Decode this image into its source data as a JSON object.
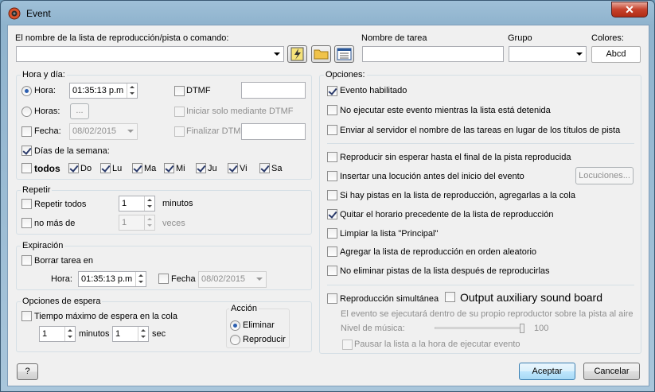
{
  "window": {
    "title": "Event",
    "close_glyph": "✕"
  },
  "top": {
    "playlist_label": "El nombre de la lista de reproducción/pista o comando:",
    "playlist_value": "",
    "task_name_label": "Nombre de tarea",
    "task_name_value": "",
    "group_label": "Grupo",
    "group_value": "",
    "colors_label": "Colores:",
    "colors_button": "Abcd"
  },
  "time_group": {
    "title": "Hora y día:",
    "hora_label": "Hora:",
    "hora_value": "01:35:13 p.m",
    "horas_label": "Horas:",
    "horas_button": "...",
    "fecha_label": "Fecha:",
    "fecha_value": "08/02/2015",
    "dtmf_label": "DTMF",
    "dtmf_value": "",
    "dtmf_start_label": "Iniciar solo mediante DTMF",
    "dtmf_end_label": "Finalizar DTMF",
    "dtmf_end_value": "",
    "weekdays_label": "Días de la semana:",
    "all_label": "todos",
    "days": [
      "Do",
      "Lu",
      "Ma",
      "Mi",
      "Ju",
      "Vi",
      "Sa"
    ]
  },
  "repeat_group": {
    "title": "Repetir",
    "repeat_label": "Repetir todos",
    "repeat_value": "1",
    "minutes_label": "minutos",
    "max_label": "no más de",
    "max_value": "1",
    "times_label": "veces"
  },
  "expire_group": {
    "title": "Expiración",
    "delete_label": "Borrar tarea en",
    "hora_label": "Hora:",
    "hora_value": "01:35:13 p.m",
    "fecha_label": "Fecha",
    "fecha_value": "08/02/2015"
  },
  "wait_group": {
    "title": "Opciones de espera",
    "max_wait_label": "Tiempo máximo de espera en la cola",
    "minutes_value": "1",
    "minutes_label": "minutos",
    "seconds_value": "1",
    "seconds_label": "sec",
    "action_title": "Acción",
    "action_delete": "Eliminar",
    "action_play": "Reproducir"
  },
  "options": {
    "title": "Opciones:",
    "items": [
      "Evento habilitado",
      "No ejecutar este evento mientras la lista está detenida",
      "Enviar al servidor el nombre de las tareas en lugar de los títulos de pista",
      "Reproducir sin esperar hasta el final de la pista reproducida",
      "Insertar una locución antes del inicio del evento",
      "Si hay pistas en la lista de reproducción, agregarlas a la cola",
      "Quitar el horario precedente de la lista de reproducción",
      "Limpiar la lista \"Principal\"",
      "Agregar la lista de reproducción en orden aleatorio",
      "No eliminar pistas de la lista después de reproducirlas"
    ],
    "locutions_button": "Locuciones...",
    "simultaneous_label": "Reproducción simultánea",
    "aux_label": "Output auxiliary sound board",
    "simultaneous_note": "El evento se ejecutará dentro de su propio reproductor sobre la pista al aire",
    "music_level_label": "Nivel de música:",
    "music_level_value": "100",
    "music_level_fraction": 1.0,
    "pause_label": "Pausar la lista a la hora de ejecutar evento"
  },
  "footer": {
    "help": "?",
    "accept": "Aceptar",
    "cancel": "Cancelar"
  }
}
